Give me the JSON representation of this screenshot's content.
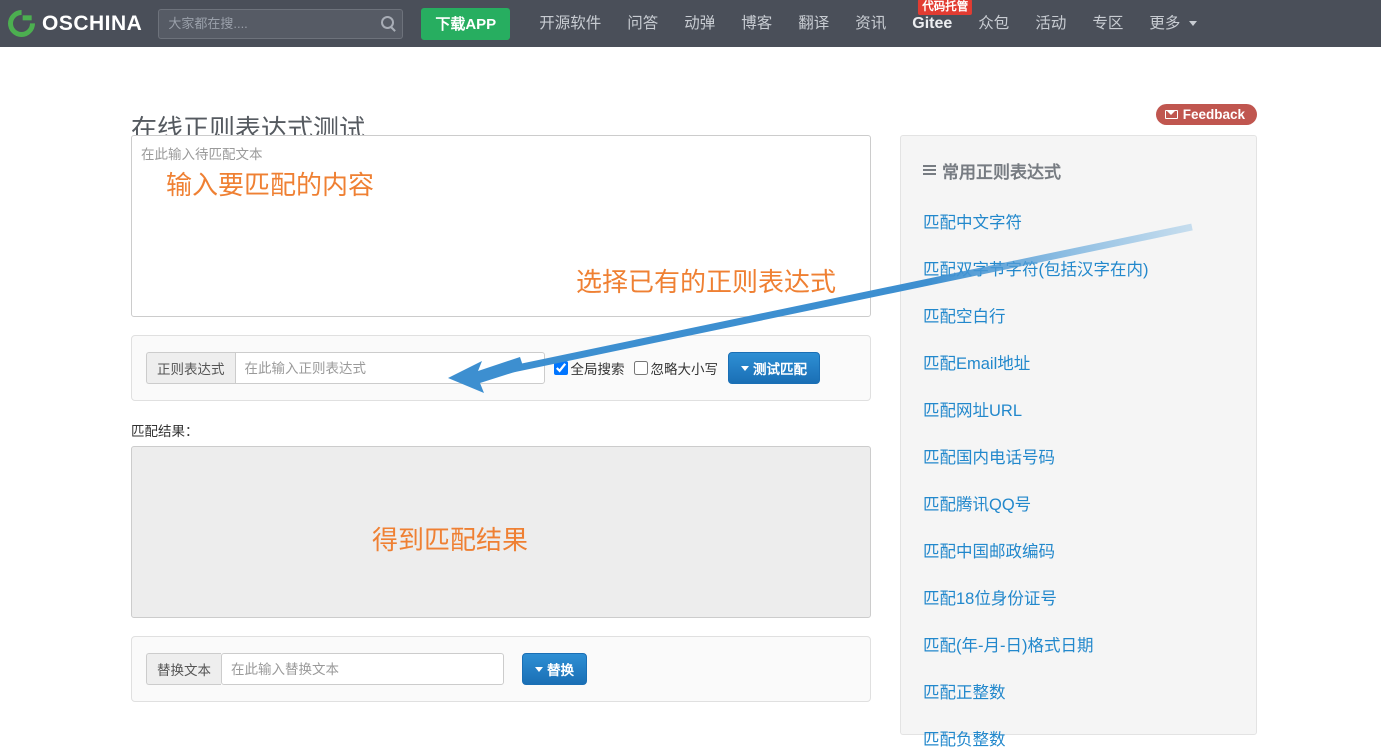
{
  "nav": {
    "logo_text": "OSCHINA",
    "search_placeholder": "大家都在搜....",
    "search_value": "",
    "download_label": "下载APP",
    "links": [
      {
        "label": "开源软件",
        "badge": null,
        "strong": false
      },
      {
        "label": "问答",
        "badge": null,
        "strong": false
      },
      {
        "label": "动弹",
        "badge": null,
        "strong": false
      },
      {
        "label": "博客",
        "badge": null,
        "strong": false
      },
      {
        "label": "翻译",
        "badge": null,
        "strong": false
      },
      {
        "label": "资讯",
        "badge": null,
        "strong": false
      },
      {
        "label": "Gitee",
        "badge": "代码托管",
        "strong": true
      },
      {
        "label": "众包",
        "badge": null,
        "strong": false
      },
      {
        "label": "活动",
        "badge": null,
        "strong": false
      },
      {
        "label": "专区",
        "badge": null,
        "strong": false
      },
      {
        "label": "更多",
        "badge": null,
        "strong": false,
        "caret": true
      }
    ]
  },
  "page": {
    "title": "在线正则表达式测试",
    "feedback_label": "Feedback"
  },
  "form": {
    "input_placeholder": "在此输入待匹配文本",
    "input_value": "",
    "regex_addon_label": "正则表达式",
    "regex_placeholder": "在此输入正则表达式",
    "regex_value": "",
    "global_label": "全局搜索",
    "global_checked": true,
    "ignorecase_label": "忽略大小写",
    "ignorecase_checked": false,
    "test_button_label": "测试匹配",
    "result_label": "匹配结果：",
    "result_value": "",
    "replace_addon_label": "替换文本",
    "replace_placeholder": "在此输入替换文本",
    "replace_value": "",
    "replace_button_label": "替换"
  },
  "annotations": {
    "color": "#ef8033",
    "arrow_color": "#3d8fd0",
    "input_note": "输入要匹配的内容",
    "select_note": "选择已有的正则表达式",
    "result_note": "得到匹配结果"
  },
  "sidebar": {
    "title": "常用正则表达式",
    "items": [
      {
        "label": "匹配中文字符"
      },
      {
        "label": "匹配双字节字符(包括汉字在内)"
      },
      {
        "label": "匹配空白行"
      },
      {
        "label": "匹配Email地址"
      },
      {
        "label": "匹配网址URL"
      },
      {
        "label": "匹配国内电话号码"
      },
      {
        "label": "匹配腾讯QQ号"
      },
      {
        "label": "匹配中国邮政编码"
      },
      {
        "label": "匹配18位身份证号"
      },
      {
        "label": "匹配(年-月-日)格式日期"
      },
      {
        "label": "匹配正整数"
      },
      {
        "label": "匹配负整数"
      }
    ]
  },
  "colors": {
    "nav_bg": "#4a4f59",
    "brand_green": "#27ae60",
    "link_blue": "#2288cc",
    "primary_blue": "#1a6fb5",
    "feedback_red": "#c0564f",
    "annotation_orange": "#ef8033"
  }
}
